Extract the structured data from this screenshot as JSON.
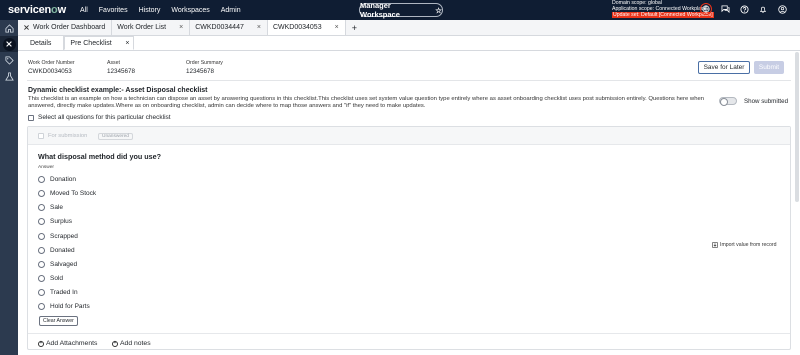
{
  "nav": {
    "logo_pre": "servicen",
    "logo_o": "o",
    "logo_post": "w",
    "menu": [
      "All",
      "Favorites",
      "History",
      "Workspaces",
      "Admin"
    ],
    "workspace_pill": "Manager Workspace",
    "star": "☆",
    "scope_domain": "Domain scope: global",
    "scope_app": "Application scope: Connected Workplace",
    "update_set": "Update set: Default [Connected Workplace]"
  },
  "workspace_tabs": [
    {
      "label": "Work Order Dashboard"
    },
    {
      "label": "Work Order List",
      "close": "×"
    },
    {
      "label": "CWKD0034447",
      "close": "×"
    },
    {
      "label": "CWKD0034053",
      "close": "×"
    }
  ],
  "add_tab": "+",
  "sub_tabs": {
    "details": "Details",
    "pre_checklist": "Pre Checklist",
    "close": "×"
  },
  "header": {
    "work_order_label": "Work Order Number",
    "work_order_value": "CWKD0034053",
    "asset_label": "Asset",
    "asset_value": "12345678",
    "order_summary_label": "Order Summary",
    "order_summary_value": "12345678",
    "save_for_later": "Save for Later",
    "submit": "Submit"
  },
  "checklist": {
    "title": "Dynamic checklist example:- Asset Disposal checklist",
    "description": "This checklist is an example on how a technician can dispose an asset by answering questions in this checklist.This checklist uses set system value question type entirely where as asset onboarding checklist uses post submission entirely. Questions here when answered, directly make updates.Where as on onboarding checklist, admin can decide where to map those answers and \"if\" they need to make updates.",
    "show_submitted": "Show submitted",
    "select_all": "Select all questions for this particular checklist"
  },
  "question": {
    "for_submission": "For submission",
    "status": "Unanswered",
    "text": "What disposal method did you use?",
    "answer_label": "Answer",
    "options": [
      "Donation",
      "Moved To Stock",
      "Sale",
      "Surplus",
      "Scrapped",
      "Donated",
      "Salvaged",
      "Sold",
      "Traded In",
      "Hold for Parts"
    ],
    "clear_answer": "Clear Answer",
    "import_value": "Import value from record",
    "add_attachments": "Add Attachments",
    "add_notes": "Add notes"
  }
}
